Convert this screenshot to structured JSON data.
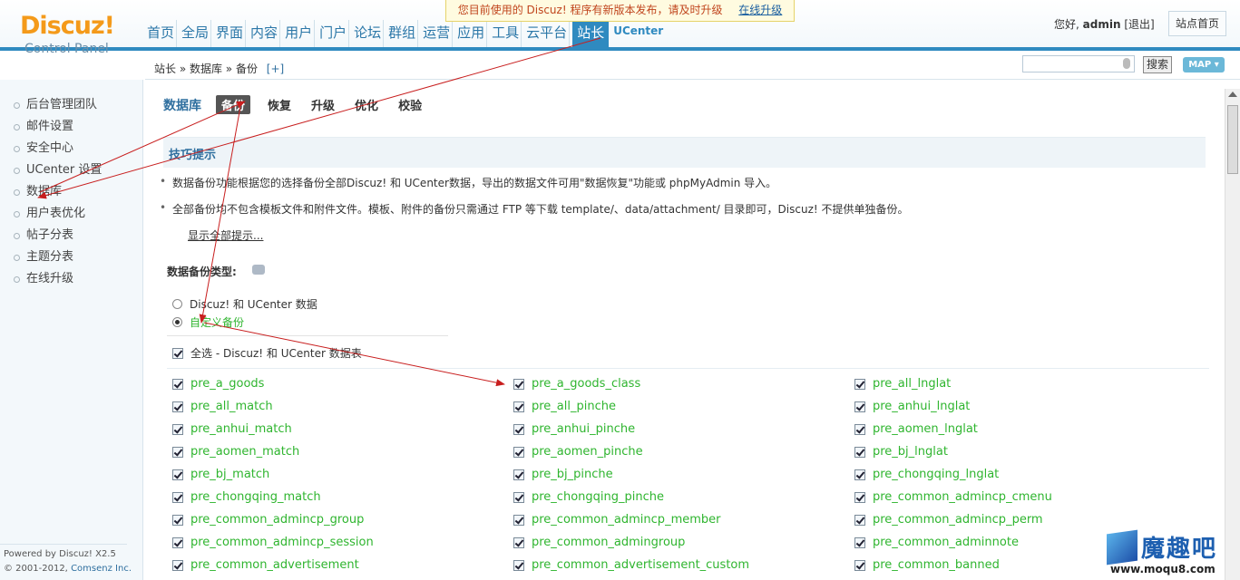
{
  "header": {
    "logo_brand": "Discuz!",
    "logo_sub": "Control Panel",
    "notice_text": "您目前使用的 Discuz! 程序有新版本发布，请及时升级",
    "notice_link": "在线升级",
    "nav": [
      "首页",
      "全局",
      "界面",
      "内容",
      "用户",
      "门户",
      "论坛",
      "群组",
      "运营",
      "应用",
      "工具",
      "云平台",
      "站长",
      "UCenter"
    ],
    "user_greeting": "您好,",
    "username": "admin",
    "logout": "[退出]",
    "site_home": "站点首页"
  },
  "crumbbar": {
    "path": "站长 » 数据库 » 备份",
    "add": "[+]",
    "search_button": "搜索",
    "map_button": "MAP ▾"
  },
  "sidebar": {
    "items": [
      "后台管理团队",
      "邮件设置",
      "安全中心",
      "UCenter 设置",
      "数据库",
      "用户表优化",
      "帖子分表",
      "主题分表",
      "在线升级"
    ],
    "footer_powered": "Powered by Discuz! X2.5",
    "footer_copyright": "© 2001-2012,",
    "footer_company": "Comsenz Inc."
  },
  "main": {
    "title": "数据库",
    "tabs": [
      "备份",
      "恢复",
      "升级",
      "优化",
      "校验"
    ],
    "tips_title": "技巧提示",
    "tips": [
      "数据备份功能根据您的选择备份全部Discuz! 和 UCenter数据，导出的数据文件可用\"数据恢复\"功能或 phpMyAdmin 导入。",
      "全部备份均不包含模板文件和附件文件。模板、附件的备份只需通过 FTP 等下载 template/、data/attachment/ 目录即可，Discuz! 不提供单独备份。"
    ],
    "show_all": "显示全部提示...",
    "backup_type_label": "数据备份类型:",
    "radio_options": [
      "Discuz! 和 UCenter 数据",
      "自定义备份"
    ],
    "select_all": "全选 - Discuz! 和 UCenter 数据表",
    "tables": [
      [
        "pre_a_goods",
        "pre_a_goods_class",
        "pre_all_lnglat"
      ],
      [
        "pre_all_match",
        "pre_all_pinche",
        "pre_anhui_lnglat"
      ],
      [
        "pre_anhui_match",
        "pre_anhui_pinche",
        "pre_aomen_lnglat"
      ],
      [
        "pre_aomen_match",
        "pre_aomen_pinche",
        "pre_bj_lnglat"
      ],
      [
        "pre_bj_match",
        "pre_bj_pinche",
        "pre_chongqing_lnglat"
      ],
      [
        "pre_chongqing_match",
        "pre_chongqing_pinche",
        "pre_common_admincp_cmenu"
      ],
      [
        "pre_common_admincp_group",
        "pre_common_admincp_member",
        "pre_common_admincp_perm"
      ],
      [
        "pre_common_admincp_session",
        "pre_common_admingroup",
        "pre_common_adminnote"
      ],
      [
        "pre_common_advertisement",
        "pre_common_advertisement_custom",
        "pre_common_banned"
      ]
    ]
  },
  "watermark": {
    "text": "魔趣吧",
    "url": "www.moqu8.com"
  },
  "colors": {
    "accent": "#2f8ac0",
    "logo": "#f49a1a",
    "table_name": "#2fb52f",
    "arrow": "#c81e1e"
  }
}
